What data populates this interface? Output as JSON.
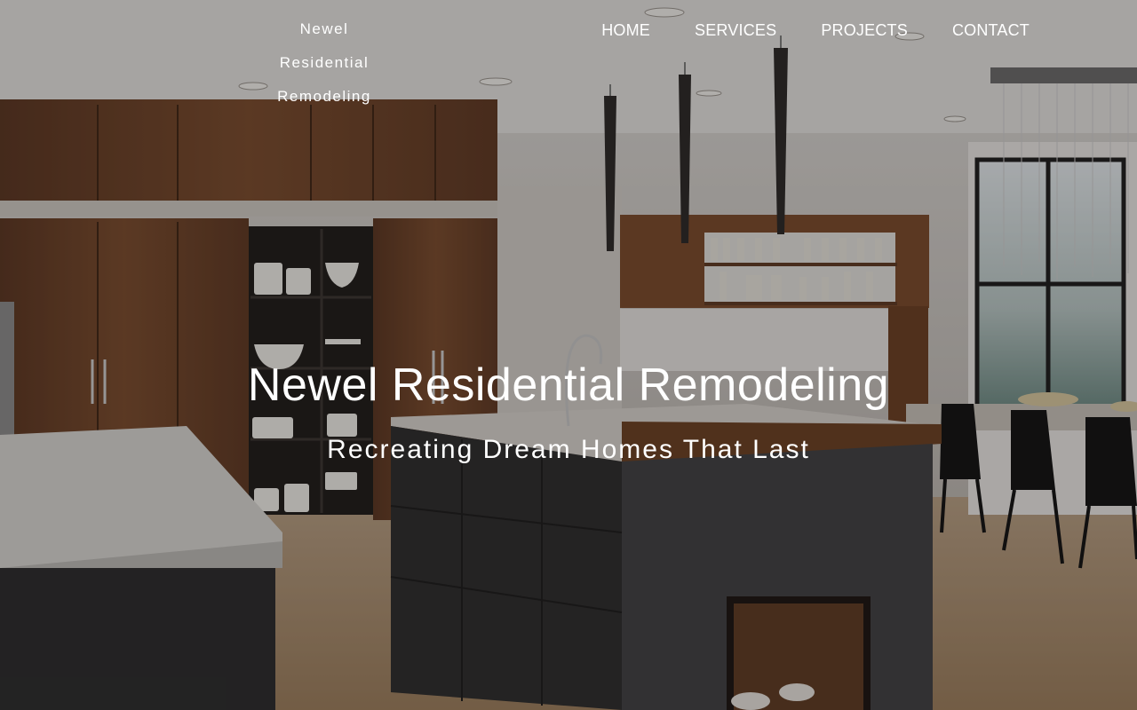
{
  "site": {
    "brand_lines": [
      "Newel",
      "Residential",
      "Remodeling"
    ]
  },
  "nav": {
    "items": [
      {
        "label": "HOME"
      },
      {
        "label": "SERVICES"
      },
      {
        "label": "PROJECTS"
      },
      {
        "label": "CONTACT"
      }
    ]
  },
  "hero": {
    "title": "Newel Residential Remodeling",
    "subtitle": "Recreating Dream Homes That Last",
    "background_image": "modern-kitchen-photo"
  },
  "colors": {
    "text": "#ffffff",
    "overlay": "rgba(20,18,16,0.30)",
    "wood": "#6b4227",
    "island": "#3d3e40",
    "countertop": "#d8d6d2",
    "floor": "#a58563"
  }
}
